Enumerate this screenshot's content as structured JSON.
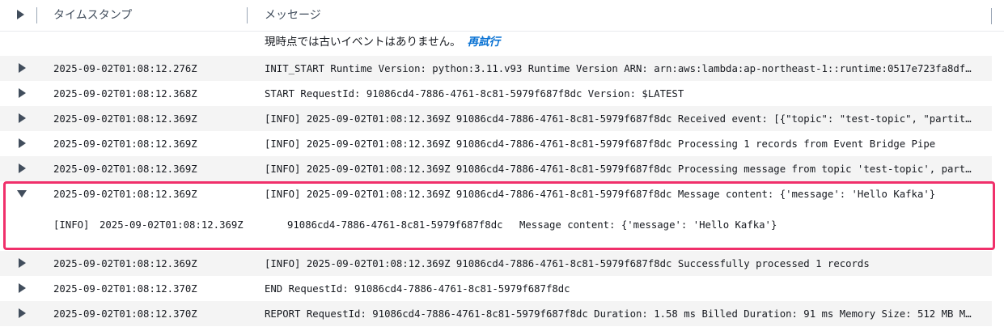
{
  "header": {
    "timestamp_label": "タイムスタンプ",
    "message_label": "メッセージ"
  },
  "notice": {
    "text": "現時点では古いイベントはありません。",
    "retry_link": "再試行"
  },
  "rows": [
    {
      "timestamp": "2025-09-02T01:08:12.276Z",
      "message": "INIT_START Runtime Version: python:3.11.v93 Runtime Version ARN: arn:aws:lambda:ap-northeast-1::runtime:0517e723fa8dfc41b…"
    },
    {
      "timestamp": "2025-09-02T01:08:12.368Z",
      "message": "START RequestId: 91086cd4-7886-4761-8c81-5979f687f8dc Version: $LATEST"
    },
    {
      "timestamp": "2025-09-02T01:08:12.369Z",
      "message": "[INFO] 2025-09-02T01:08:12.369Z 91086cd4-7886-4761-8c81-5979f687f8dc Received event: [{\"topic\": \"test-topic\", \"partition\"…"
    },
    {
      "timestamp": "2025-09-02T01:08:12.369Z",
      "message": "[INFO] 2025-09-02T01:08:12.369Z 91086cd4-7886-4761-8c81-5979f687f8dc Processing 1 records from Event Bridge Pipe"
    },
    {
      "timestamp": "2025-09-02T01:08:12.369Z",
      "message": "[INFO] 2025-09-02T01:08:12.369Z 91086cd4-7886-4761-8c81-5979f687f8dc Processing message from topic 'test-topic', partitio…"
    },
    {
      "timestamp": "2025-09-02T01:08:12.369Z",
      "message": "[INFO] 2025-09-02T01:08:12.369Z 91086cd4-7886-4761-8c81-5979f687f8dc Message content: {'message': 'Hello Kafka'}"
    },
    {
      "timestamp": "2025-09-02T01:08:12.369Z",
      "message": "[INFO] 2025-09-02T01:08:12.369Z 91086cd4-7886-4761-8c81-5979f687f8dc Successfully processed 1 records"
    },
    {
      "timestamp": "2025-09-02T01:08:12.370Z",
      "message": "END RequestId: 91086cd4-7886-4761-8c81-5979f687f8dc"
    },
    {
      "timestamp": "2025-09-02T01:08:12.370Z",
      "message": "REPORT RequestId: 91086cd4-7886-4761-8c81-5979f687f8dc Duration: 1.58 ms Billed Duration: 91 ms Memory Size: 512 MB Max M…"
    }
  ],
  "expanded_detail": {
    "level": "[INFO]",
    "timestamp": "2025-09-02T01:08:12.369Z",
    "request_id": "91086cd4-7886-4761-8c81-5979f687f8dc",
    "message": "Message content: {'message': 'Hello Kafka'}"
  }
}
